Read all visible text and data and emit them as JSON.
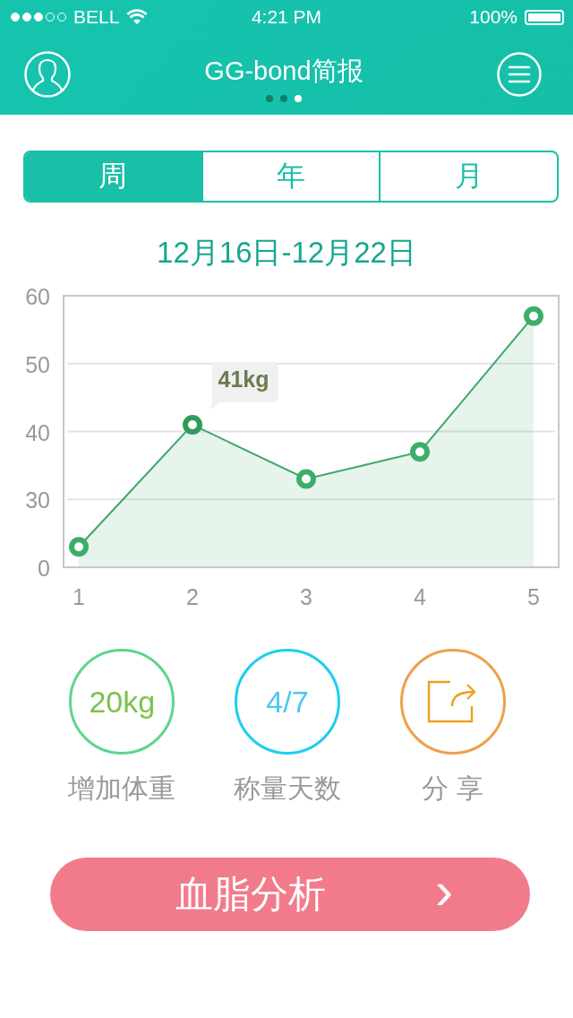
{
  "status_bar": {
    "signal_dots": [
      {
        "filled": true
      },
      {
        "filled": true
      },
      {
        "filled": true
      },
      {
        "filled": false
      },
      {
        "filled": false
      }
    ],
    "carrier": "BELL",
    "time": "4:21 PM",
    "battery_text": "100%",
    "battery": {
      "level": 1
    }
  },
  "header": {
    "title": "GG-bond简报",
    "page_dots": [
      {
        "selected": false
      },
      {
        "selected": false
      },
      {
        "selected": true
      }
    ]
  },
  "tabs": [
    {
      "label": "周",
      "selected": true
    },
    {
      "label": "年",
      "selected": false
    },
    {
      "label": "月",
      "selected": false
    }
  ],
  "date_range": "12月16日-12月22日",
  "chart_data": {
    "type": "area",
    "categories": [
      "1",
      "2",
      "3",
      "4",
      "5"
    ],
    "series": [
      {
        "color": "#3aa866",
        "values": [
          23,
          41,
          33,
          37,
          57
        ]
      }
    ],
    "ylim": [
      20,
      60
    ],
    "yticks": [
      30,
      40,
      50,
      60
    ],
    "grid": true
  },
  "chart_axis_origin_label": "0",
  "chart_point_tooltips": [
    {
      "shown": false
    },
    {
      "shown": true,
      "text": "41kg"
    },
    {
      "shown": false
    },
    {
      "shown": false
    },
    {
      "shown": false
    }
  ],
  "stats": [
    {
      "kind": "text",
      "value": "20kg",
      "label": "增加体重",
      "color": "#5dd68a"
    },
    {
      "kind": "text",
      "value": "4/7",
      "label": "称量天数",
      "color": "#1ecdf0"
    },
    {
      "kind": "share",
      "label": "分 享",
      "color": "#eea04c"
    }
  ],
  "action_button": {
    "label": "血脂分析",
    "arrow": "›"
  }
}
